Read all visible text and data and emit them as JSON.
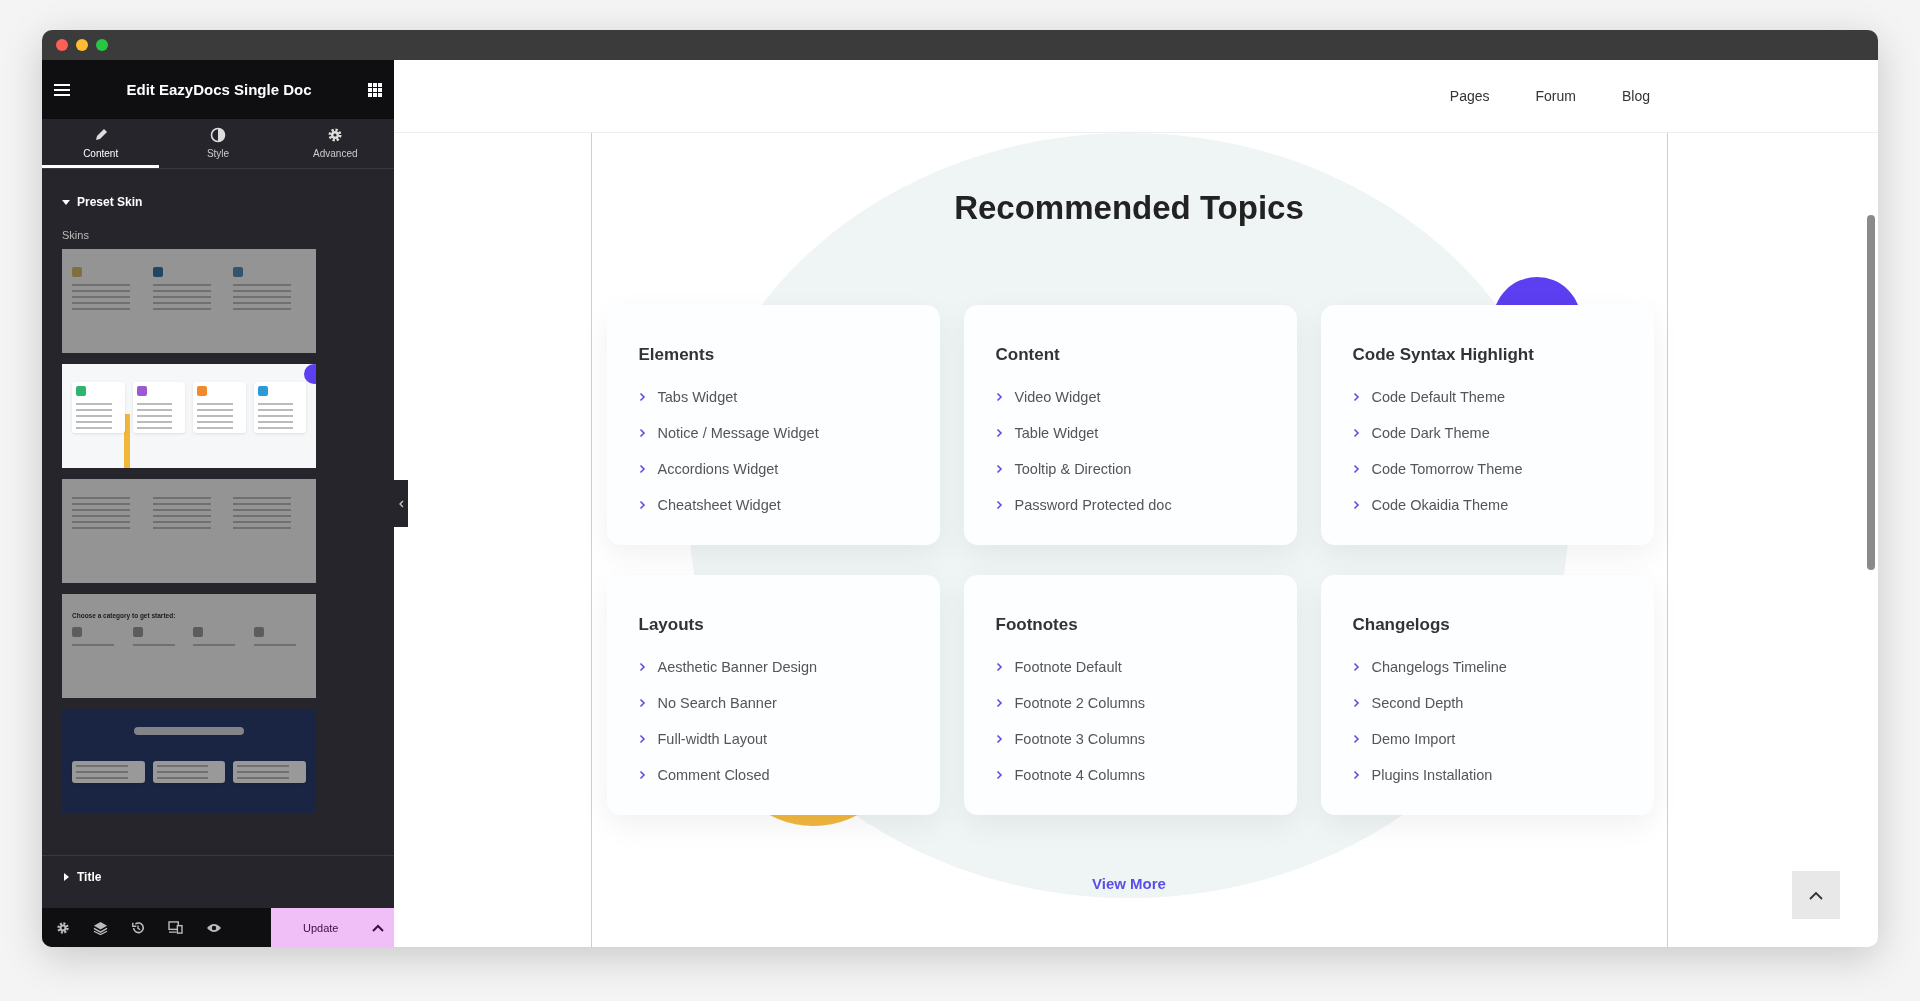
{
  "window": {
    "title": "Edit EazyDocs Single Doc"
  },
  "editor_tabs": [
    {
      "label": "Content",
      "selected": true
    },
    {
      "label": "Style",
      "selected": false
    },
    {
      "label": "Advanced",
      "selected": false
    }
  ],
  "preset_skin": {
    "title": "Preset Skin",
    "expanded": true,
    "label": "Skins",
    "skins": [
      {
        "kind": "icons",
        "selected": false
      },
      {
        "kind": "cards",
        "selected": true
      },
      {
        "kind": "columns",
        "selected": false
      },
      {
        "kind": "category",
        "selected": false,
        "caption": "Choose a category to get started:"
      },
      {
        "kind": "banner",
        "selected": false
      }
    ]
  },
  "title_section": {
    "title": "Title",
    "expanded": false
  },
  "footer": {
    "update_button": "Update"
  },
  "nav": [
    "Pages",
    "Forum",
    "Blog"
  ],
  "heading": "Recommended Topics",
  "topics": [
    {
      "title": "Elements",
      "items": [
        "Tabs Widget",
        "Notice / Message Widget",
        "Accordions Widget",
        "Cheatsheet Widget"
      ]
    },
    {
      "title": "Content",
      "items": [
        "Video Widget",
        "Table Widget",
        "Tooltip & Direction",
        "Password Protected doc"
      ]
    },
    {
      "title": "Code Syntax Highlight",
      "items": [
        "Code Default Theme",
        "Code Dark Theme",
        "Code Tomorrow Theme",
        "Code Okaidia Theme"
      ]
    },
    {
      "title": "Layouts",
      "items": [
        "Aesthetic Banner Design",
        "No Search Banner",
        "Full-width Layout",
        "Comment Closed"
      ]
    },
    {
      "title": "Footnotes",
      "items": [
        "Footnote Default",
        "Footnote 2 Columns",
        "Footnote 3 Columns",
        "Footnote 4 Columns"
      ]
    },
    {
      "title": "Changelogs",
      "items": [
        "Changelogs Timeline",
        "Second Depth",
        "Demo Import",
        "Plugins Installation"
      ]
    }
  ],
  "view_more": "View More"
}
